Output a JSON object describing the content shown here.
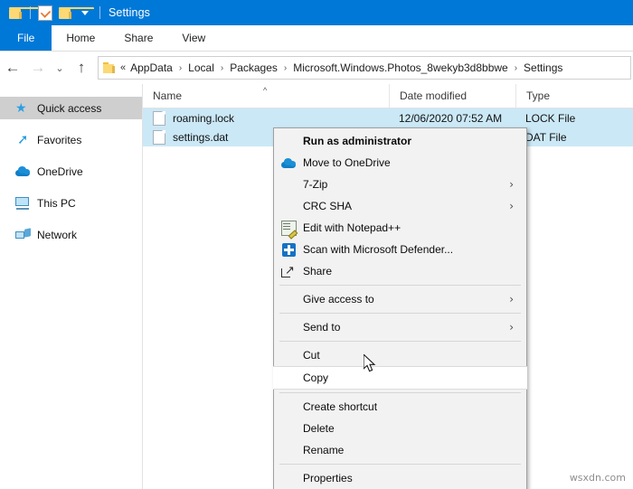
{
  "window": {
    "title": "Settings",
    "quick_access_toolbar": [
      {
        "icon": "folder-icon",
        "name": "properties-folder-icon"
      },
      {
        "icon": "document-check-icon",
        "name": "new-folder-icon"
      },
      {
        "icon": "folder-icon",
        "name": "customize-folder-icon"
      },
      {
        "icon": "chevron-down-icon",
        "name": "customize-toolbar-dropdown"
      }
    ]
  },
  "ribbon": {
    "tabs": [
      {
        "label": "File",
        "active": true
      },
      {
        "label": "Home",
        "active": false
      },
      {
        "label": "Share",
        "active": false
      },
      {
        "label": "View",
        "active": false
      }
    ]
  },
  "navigation": {
    "back_label": "←",
    "forward_label": "→",
    "recent_label": "⌄",
    "up_label": "↑",
    "address": {
      "overflow_label": "«",
      "crumbs": [
        "AppData",
        "Local",
        "Packages",
        "Microsoft.Windows.Photos_8wekyb3d8bbwe",
        "Settings"
      ],
      "separator": "›"
    }
  },
  "sidebar": {
    "items": [
      {
        "label": "Quick access",
        "icon": "pin-star-icon",
        "selected": true
      },
      {
        "label": "Favorites",
        "icon": "favorites-arrow-icon",
        "selected": false
      },
      {
        "label": "OneDrive",
        "icon": "onedrive-cloud-icon",
        "selected": false
      },
      {
        "label": "This PC",
        "icon": "this-pc-monitor-icon",
        "selected": false
      },
      {
        "label": "Network",
        "icon": "network-icon",
        "selected": false
      }
    ]
  },
  "file_list": {
    "columns": [
      {
        "label": "Name",
        "sorted": "asc",
        "sort_glyph": "^"
      },
      {
        "label": "Date modified",
        "sorted": "",
        "sort_glyph": ""
      },
      {
        "label": "Type",
        "sorted": "",
        "sort_glyph": ""
      }
    ],
    "rows": [
      {
        "name": "roaming.lock",
        "date_modified": "12/06/2020 07:52 AM",
        "type": "LOCK File",
        "selected": true
      },
      {
        "name": "settings.dat",
        "date_modified": "",
        "type": "DAT File",
        "selected": true
      }
    ]
  },
  "context_menu": {
    "items": [
      {
        "label": "Run as administrator",
        "icon": "",
        "bold": true,
        "submenu": false,
        "hover": false,
        "separator_after": false
      },
      {
        "label": "Move to OneDrive",
        "icon": "onedrive-cloud-icon",
        "bold": false,
        "submenu": false,
        "hover": false,
        "separator_after": false
      },
      {
        "label": "7-Zip",
        "icon": "",
        "bold": false,
        "submenu": true,
        "hover": false,
        "separator_after": false
      },
      {
        "label": "CRC SHA",
        "icon": "",
        "bold": false,
        "submenu": true,
        "hover": false,
        "separator_after": false
      },
      {
        "label": "Edit with Notepad++",
        "icon": "notepad-plus-plus-icon",
        "bold": false,
        "submenu": false,
        "hover": false,
        "separator_after": false
      },
      {
        "label": "Scan with Microsoft Defender...",
        "icon": "defender-shield-icon",
        "bold": false,
        "submenu": false,
        "hover": false,
        "separator_after": false
      },
      {
        "label": "Share",
        "icon": "share-icon",
        "bold": false,
        "submenu": false,
        "hover": false,
        "separator_after": true
      },
      {
        "label": "Give access to",
        "icon": "",
        "bold": false,
        "submenu": true,
        "hover": false,
        "separator_after": true
      },
      {
        "label": "Send to",
        "icon": "",
        "bold": false,
        "submenu": true,
        "hover": false,
        "separator_after": true
      },
      {
        "label": "Cut",
        "icon": "",
        "bold": false,
        "submenu": false,
        "hover": false,
        "separator_after": false
      },
      {
        "label": "Copy",
        "icon": "",
        "bold": false,
        "submenu": false,
        "hover": true,
        "separator_after": true
      },
      {
        "label": "Create shortcut",
        "icon": "",
        "bold": false,
        "submenu": false,
        "hover": false,
        "separator_after": false
      },
      {
        "label": "Delete",
        "icon": "",
        "bold": false,
        "submenu": false,
        "hover": false,
        "separator_after": false
      },
      {
        "label": "Rename",
        "icon": "",
        "bold": false,
        "submenu": false,
        "hover": false,
        "separator_after": true
      },
      {
        "label": "Properties",
        "icon": "",
        "bold": false,
        "submenu": false,
        "hover": false,
        "separator_after": false
      }
    ],
    "submenu_arrow": "›"
  },
  "watermark": {
    "text": "wsxdn.com"
  },
  "colors": {
    "accent": "#0078d7",
    "selection": "#cbe8f6",
    "sidebar_selected": "#cfcfcf",
    "menu_bg": "#f2f2f2"
  }
}
